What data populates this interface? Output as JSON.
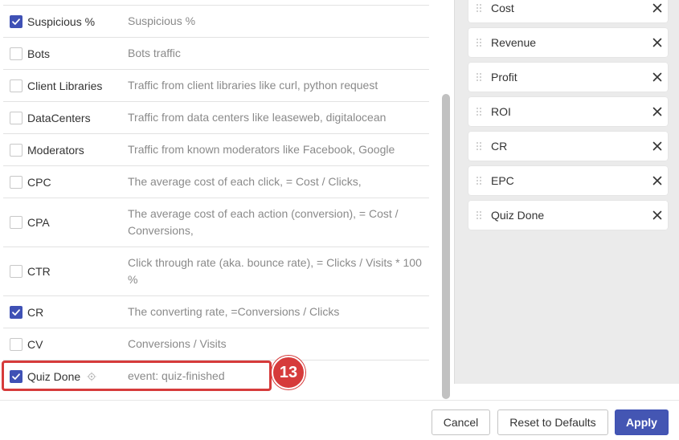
{
  "metrics": [
    {
      "name": "Suspicious %",
      "description": "Suspicious %",
      "checked": true
    },
    {
      "name": "Bots",
      "description": "Bots traffic",
      "checked": false
    },
    {
      "name": "Client Libraries",
      "description": "Traffic from client libraries like curl, python request",
      "checked": false
    },
    {
      "name": "DataCenters",
      "description": "Traffic from data centers like leaseweb, digitalocean",
      "checked": false
    },
    {
      "name": "Moderators",
      "description": "Traffic from known moderators like Facebook, Google",
      "checked": false
    },
    {
      "name": "CPC",
      "description": "The average cost of each click, = Cost / Clicks,",
      "checked": false
    },
    {
      "name": "CPA",
      "description": "The average cost of each action (conversion), = Cost / Conversions,",
      "checked": false
    },
    {
      "name": "CTR",
      "description": "Click through rate (aka. bounce rate), = Clicks / Visits * 100 %",
      "checked": false
    },
    {
      "name": "CR",
      "description": "The converting rate, =Conversions / Clicks",
      "checked": true
    },
    {
      "name": "CV",
      "description": "Conversions / Visits",
      "checked": false
    },
    {
      "name": "Quiz Done",
      "description": "event: quiz-finished",
      "checked": true,
      "has_target_icon": true
    }
  ],
  "selected_columns": [
    "Cost",
    "Revenue",
    "Profit",
    "ROI",
    "CR",
    "EPC",
    "Quiz Done"
  ],
  "step_badge": "13",
  "footer": {
    "cancel_label": "Cancel",
    "reset_label": "Reset to Defaults",
    "apply_label": "Apply"
  },
  "colors": {
    "accent": "#3f51b5",
    "highlight": "#d63b3b",
    "panel_bg": "#ebebeb"
  },
  "icons": {
    "checkbox_checked": "check-icon",
    "remove": "close-icon",
    "drag": "drag-handle-icon",
    "event": "target-icon"
  }
}
